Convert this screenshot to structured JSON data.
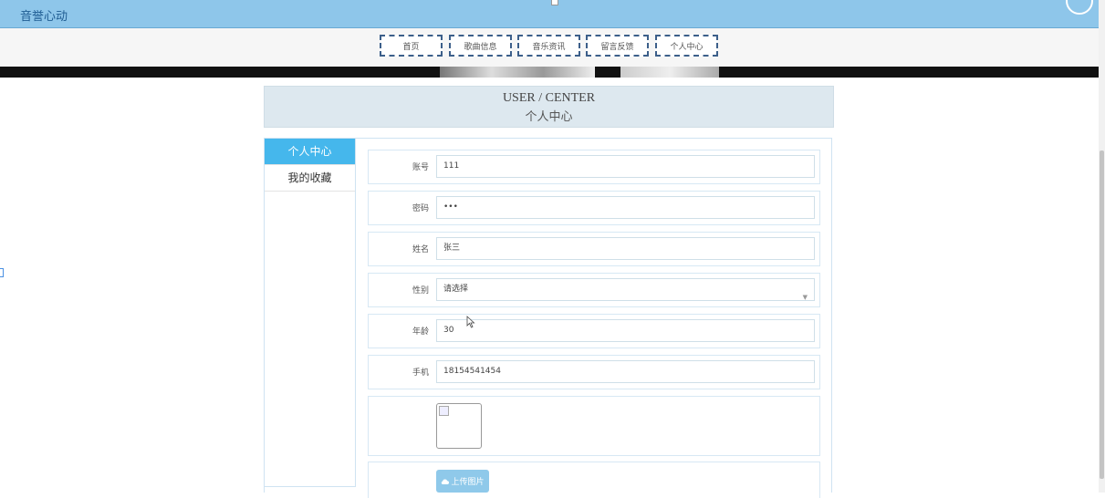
{
  "app": {
    "title": "音誉心动"
  },
  "nav": {
    "items": [
      {
        "label": "首页"
      },
      {
        "label": "歌曲信息"
      },
      {
        "label": "音乐资讯"
      },
      {
        "label": "留言反馈"
      },
      {
        "label": "个人中心"
      }
    ]
  },
  "header": {
    "en_title": "USER / CENTER",
    "cn_title": "个人中心"
  },
  "sidebar": {
    "items": [
      {
        "label": "个人中心",
        "active": true
      },
      {
        "label": "我的收藏",
        "active": false
      }
    ]
  },
  "form": {
    "account": {
      "label": "账号",
      "value": "111"
    },
    "password": {
      "label": "密码",
      "value": "•••"
    },
    "name": {
      "label": "姓名",
      "value": "张三"
    },
    "gender": {
      "label": "性别",
      "value": "请选择"
    },
    "age": {
      "label": "年龄",
      "value": "30"
    },
    "phone": {
      "label": "手机",
      "value": "18154541454"
    },
    "upload_label": "上传图片"
  },
  "colors": {
    "topbar": "#8ec6ea",
    "active_menu": "#45b7ec",
    "upload_button": "#8fc9ea"
  },
  "icons": {
    "upload": "cloud-upload-icon",
    "select": "chevron-down-icon"
  }
}
